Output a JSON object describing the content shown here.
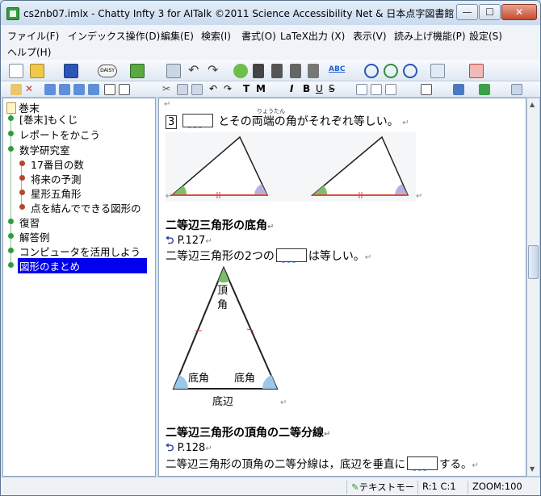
{
  "window": {
    "title": "cs2nb07.imlx - Chatty Infty 3 for AITalk ©2011 Science Accessibility Net & 日本点字図書館",
    "controls": {
      "minimize": "—",
      "maximize": "☐",
      "close": "✕"
    }
  },
  "menu": [
    "ファイル(F)",
    "インデックス操作(D)",
    "編集(E)",
    "検索(I)",
    "書式(O)",
    "LaTeX出力 (X)",
    "表示(V)",
    "読み上げ機能(P)",
    "設定(S)",
    "ヘルプ(H)"
  ],
  "toolbar1": {
    "icons": [
      "new-file-icon",
      "open-folder-icon",
      "save-icon",
      "daisy-icon",
      "export-icon",
      "print-icon",
      "undo-icon",
      "redo-icon",
      "paint-icon",
      "image-icon",
      "block-icon",
      "split-icon",
      "align-icon",
      "abc-spell-icon",
      "zoom-in-icon",
      "zoom-reset-icon",
      "zoom-out-icon",
      "text-color-icon",
      "speech-icon"
    ],
    "daisy_label": "DAISY",
    "abc_label": "ABC"
  },
  "toolbar2": {
    "format_labels": [
      "T",
      "M",
      "I",
      "B",
      "U",
      "S"
    ]
  },
  "sidebar": {
    "root_label": "巻末",
    "items": [
      {
        "label": "[巻末]もくじ",
        "level": 1,
        "dot": "green"
      },
      {
        "label": "レポートをかこう",
        "level": 1,
        "dot": "green"
      },
      {
        "label": "数学研究室",
        "level": 1,
        "dot": "green"
      },
      {
        "label": "17番目の数",
        "level": 2,
        "dot": "red"
      },
      {
        "label": "将来の予測",
        "level": 2,
        "dot": "red"
      },
      {
        "label": "星形五角形",
        "level": 2,
        "dot": "red"
      },
      {
        "label": "点を結んでできる図形の",
        "level": 2,
        "dot": "red"
      },
      {
        "label": "復習",
        "level": 1,
        "dot": "green"
      },
      {
        "label": "解答例",
        "level": 1,
        "dot": "green"
      },
      {
        "label": "コンピュータを活用しよう",
        "level": 1,
        "dot": "green"
      },
      {
        "label": "図形のまとめ",
        "level": 1,
        "dot": "green",
        "selected": true
      }
    ]
  },
  "document": {
    "line1": {
      "num": "3",
      "text": "とその両端の角がそれぞれ等しい。",
      "ruby": "りょうたん"
    },
    "heading1": "二等辺三角形の底角",
    "ref1": "P.127",
    "line2_pre": "二等辺三角形の2つの",
    "line2_post": "は等しい。",
    "triangle_labels": {
      "apex": "頂角",
      "base_angle_left": "底角",
      "base_angle_right": "底角",
      "base": "底辺"
    },
    "heading2": "二等辺三角形の頂角の二等分線",
    "ref2": "P.128",
    "line3_pre": "二等辺三角形の頂角の二等分線は，底辺を垂直に",
    "line3_post": "する。"
  },
  "status": {
    "mode": "テキストモー",
    "position": "R:1 C:1",
    "zoom": "ZOOM:100"
  },
  "colors": {
    "selection": "#0000ee",
    "tree_green": "#2e9e3a",
    "tree_red": "#b5472c",
    "angle_green": "#7bbf6a",
    "angle_blue": "#9cc7e8",
    "base_red": "#e04a3a"
  }
}
